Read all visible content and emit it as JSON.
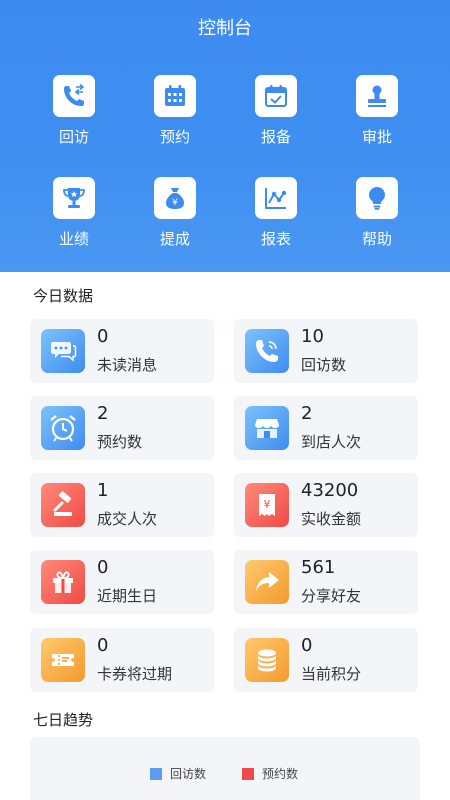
{
  "header": {
    "title": "控制台"
  },
  "grid": [
    {
      "label": "回访",
      "icon": "phone-callback-icon"
    },
    {
      "label": "预约",
      "icon": "calendar-grid-icon"
    },
    {
      "label": "报备",
      "icon": "calendar-check-icon"
    },
    {
      "label": "审批",
      "icon": "stamp-icon"
    },
    {
      "label": "业绩",
      "icon": "trophy-icon"
    },
    {
      "label": "提成",
      "icon": "money-bag-icon"
    },
    {
      "label": "报表",
      "icon": "line-chart-icon"
    },
    {
      "label": "帮助",
      "icon": "lightbulb-icon"
    }
  ],
  "today": {
    "title": "今日数据",
    "cards": [
      {
        "value": "0",
        "label": "未读消息",
        "icon": "chat-bubbles-icon"
      },
      {
        "value": "10",
        "label": "回访数",
        "icon": "phone-icon"
      },
      {
        "value": "2",
        "label": "预约数",
        "icon": "alarm-clock-icon"
      },
      {
        "value": "2",
        "label": "到店人次",
        "icon": "store-icon"
      },
      {
        "value": "1",
        "label": "成交人次",
        "icon": "gavel-icon"
      },
      {
        "value": "43200",
        "label": "实收金额",
        "icon": "yuan-receipt-icon"
      },
      {
        "value": "0",
        "label": "近期生日",
        "icon": "gift-icon"
      },
      {
        "value": "561",
        "label": "分享好友",
        "icon": "share-arrow-icon"
      },
      {
        "value": "0",
        "label": "卡券将过期",
        "icon": "ticket-icon"
      },
      {
        "value": "0",
        "label": "当前积分",
        "icon": "coin-stack-icon"
      }
    ]
  },
  "trend": {
    "title": "七日趋势",
    "legend": [
      {
        "name": "回访数",
        "color": "#5b9bf0"
      },
      {
        "name": "预约数",
        "color": "#ef4a4a"
      }
    ]
  },
  "colors": {
    "accent": "#3d8bf1",
    "card_bg": "#f3f5f9"
  }
}
